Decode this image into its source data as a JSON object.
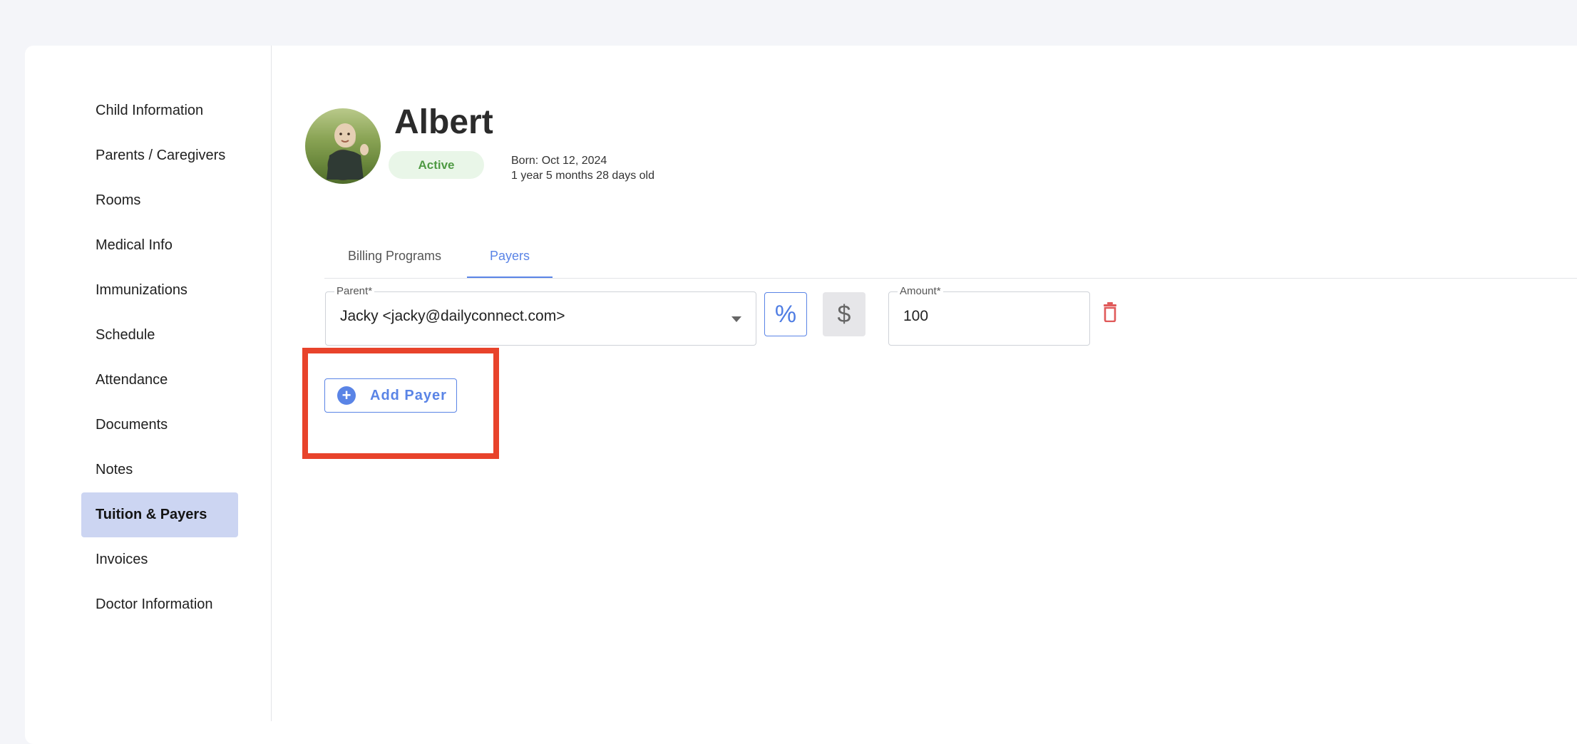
{
  "sidebar": {
    "items": [
      {
        "label": "Child Information"
      },
      {
        "label": "Parents / Caregivers"
      },
      {
        "label": "Rooms"
      },
      {
        "label": "Medical Info"
      },
      {
        "label": "Immunizations"
      },
      {
        "label": "Schedule"
      },
      {
        "label": "Attendance"
      },
      {
        "label": "Documents"
      },
      {
        "label": "Notes"
      },
      {
        "label": "Tuition & Payers"
      },
      {
        "label": "Invoices"
      },
      {
        "label": "Doctor Information"
      }
    ],
    "active_index": 9
  },
  "profile": {
    "name": "Albert",
    "status": "Active",
    "born": "Born: Oct 12, 2024",
    "age": "1 year 5 months 28 days old"
  },
  "tabs": [
    {
      "label": "Billing Programs"
    },
    {
      "label": "Payers"
    }
  ],
  "active_tab": "Payers",
  "payer_row": {
    "parent_label": "Parent*",
    "parent_value": "Jacky <jacky@dailyconnect.com>",
    "percent_symbol": "%",
    "dollar_symbol": "$",
    "amount_label": "Amount*",
    "amount_value": "100"
  },
  "add_payer": {
    "label": "Add Payer",
    "icon": "plus-circle-icon"
  },
  "colors": {
    "accent": "#5a84e6",
    "active_nav_bg": "#ccd5f2",
    "status_green": "#4f9a44",
    "delete_red": "#e05a5a",
    "highlight": "#e8432b"
  }
}
